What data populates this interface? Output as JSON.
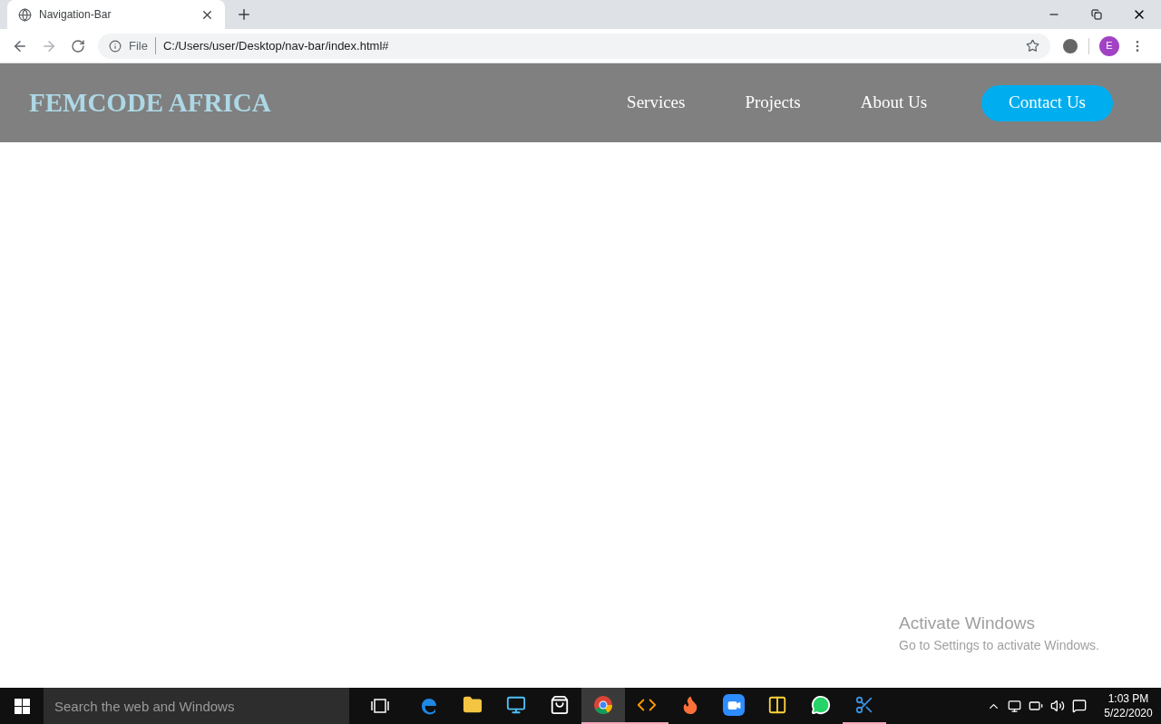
{
  "browser": {
    "tab": {
      "title": "Navigation-Bar"
    },
    "address": {
      "scheme": "File",
      "url": "C:/Users/user/Desktop/nav-bar/index.html#"
    },
    "profile": "E"
  },
  "page": {
    "brand": "FEMCODE AFRICA",
    "nav": [
      {
        "label": "Services",
        "kind": "link"
      },
      {
        "label": "Projects",
        "kind": "link"
      },
      {
        "label": "About Us",
        "kind": "link"
      },
      {
        "label": "Contact Us",
        "kind": "button"
      }
    ]
  },
  "activation": {
    "title": "Activate Windows",
    "note": "Go to Settings to activate Windows."
  },
  "taskbar": {
    "search": {
      "placeholder": "Search the web and Windows"
    },
    "apps": [
      {
        "kind": "edge",
        "running": false,
        "selected": false
      },
      {
        "kind": "folder",
        "running": false,
        "selected": false
      },
      {
        "kind": "computer",
        "running": false,
        "selected": false
      },
      {
        "kind": "store",
        "running": false,
        "selected": false
      },
      {
        "kind": "chrome",
        "running": true,
        "selected": true
      },
      {
        "kind": "sublime",
        "running": true,
        "selected": false
      },
      {
        "kind": "firefox",
        "running": false,
        "selected": false
      },
      {
        "kind": "zoom",
        "running": false,
        "selected": false
      },
      {
        "kind": "python",
        "running": false,
        "selected": false
      },
      {
        "kind": "whatsapp",
        "running": false,
        "selected": false
      },
      {
        "kind": "snipping",
        "running": true,
        "selected": false
      }
    ],
    "time": "1:03 PM",
    "date": "5/22/2020"
  }
}
